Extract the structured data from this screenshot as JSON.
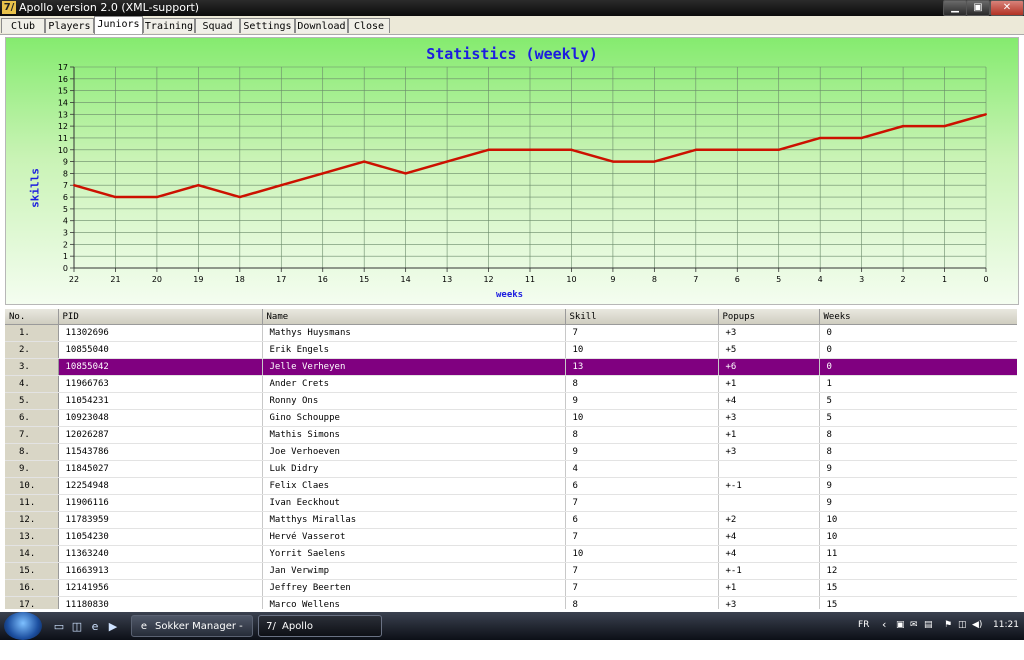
{
  "window": {
    "title": "Apollo version 2.0 (XML-support)",
    "icon": "7/",
    "min_icon": "▁",
    "max_icon": "▣",
    "close_icon": "✕"
  },
  "tabs": [
    "Club",
    "Players",
    "Juniors",
    "Training",
    "Squad",
    "Settings",
    "Download",
    "Close"
  ],
  "active_tab": "Juniors",
  "chart_data": {
    "type": "line",
    "title": "Statistics (weekly)",
    "xlabel": "weeks",
    "ylabel": "skills",
    "x": [
      22,
      21,
      20,
      19,
      18,
      17,
      16,
      15,
      14,
      13,
      12,
      11,
      10,
      9,
      8,
      7,
      6,
      5,
      4,
      3,
      2,
      1,
      0
    ],
    "series": [
      {
        "values": [
          7,
          6,
          6,
          7,
          6,
          7,
          8,
          9,
          8,
          9,
          10,
          10,
          10,
          9,
          9,
          10,
          10,
          10,
          11,
          11,
          12,
          12,
          13
        ]
      }
    ],
    "ylim": [
      0,
      17
    ],
    "yticks": [
      0,
      1,
      2,
      3,
      4,
      5,
      6,
      7,
      8,
      9,
      10,
      11,
      12,
      13,
      14,
      15,
      16,
      17
    ],
    "grid": true,
    "line_color": "#cc1100",
    "grid_color": "#6a8a6a",
    "text_color": "#1c1ce0"
  },
  "table": {
    "columns": [
      "No.",
      "PID",
      "Name",
      "Skill",
      "Popups",
      "Weeks"
    ],
    "selected_index": 2,
    "rows": [
      [
        "1.",
        "11302696",
        "Mathys Huysmans",
        "7",
        "+3",
        "0"
      ],
      [
        "2.",
        "10855040",
        "Erik Engels",
        "10",
        "+5",
        "0"
      ],
      [
        "3.",
        "10855042",
        "Jelle Verheyen",
        "13",
        "+6",
        "0"
      ],
      [
        "4.",
        "11966763",
        "Ander Crets",
        "8",
        "+1",
        "1"
      ],
      [
        "5.",
        "11054231",
        "Ronny Ons",
        "9",
        "+4",
        "5"
      ],
      [
        "6.",
        "10923048",
        "Gino Schouppe",
        "10",
        "+3",
        "5"
      ],
      [
        "7.",
        "12026287",
        "Mathis Simons",
        "8",
        "+1",
        "8"
      ],
      [
        "8.",
        "11543786",
        "Joe Verhoeven",
        "9",
        "+3",
        "8"
      ],
      [
        "9.",
        "11845027",
        "Luk Didry",
        "4",
        "",
        "9"
      ],
      [
        "10.",
        "12254948",
        "Felix Claes",
        "6",
        "+-1",
        "9"
      ],
      [
        "11.",
        "11906116",
        "Ivan Eeckhout",
        "7",
        "",
        "9"
      ],
      [
        "12.",
        "11783959",
        "Matthys Mirallas",
        "6",
        "+2",
        "10"
      ],
      [
        "13.",
        "11054230",
        "Hervé Vasserot",
        "7",
        "+4",
        "10"
      ],
      [
        "14.",
        "11363240",
        "Yorrit Saelens",
        "10",
        "+4",
        "11"
      ],
      [
        "15.",
        "11663913",
        "Jan Verwimp",
        "7",
        "+-1",
        "12"
      ],
      [
        "16.",
        "12141956",
        "Jeffrey Beerten",
        "7",
        "+1",
        "15"
      ],
      [
        "17.",
        "11180830",
        "Marco Wellens",
        "8",
        "+3",
        "15"
      ]
    ]
  },
  "taskbar": {
    "apps": [
      {
        "label": "Sokker Manager - In...",
        "icon": "e",
        "icon_name": "ie-icon"
      },
      {
        "label": "Apollo",
        "icon": "7/",
        "icon_name": "apollo-icon"
      }
    ],
    "language": "FR",
    "chevron": "‹",
    "clock": "11:21",
    "tray_icons": [
      "▣",
      "✉",
      "▤",
      "⚑",
      "◫",
      "◀)"
    ]
  }
}
